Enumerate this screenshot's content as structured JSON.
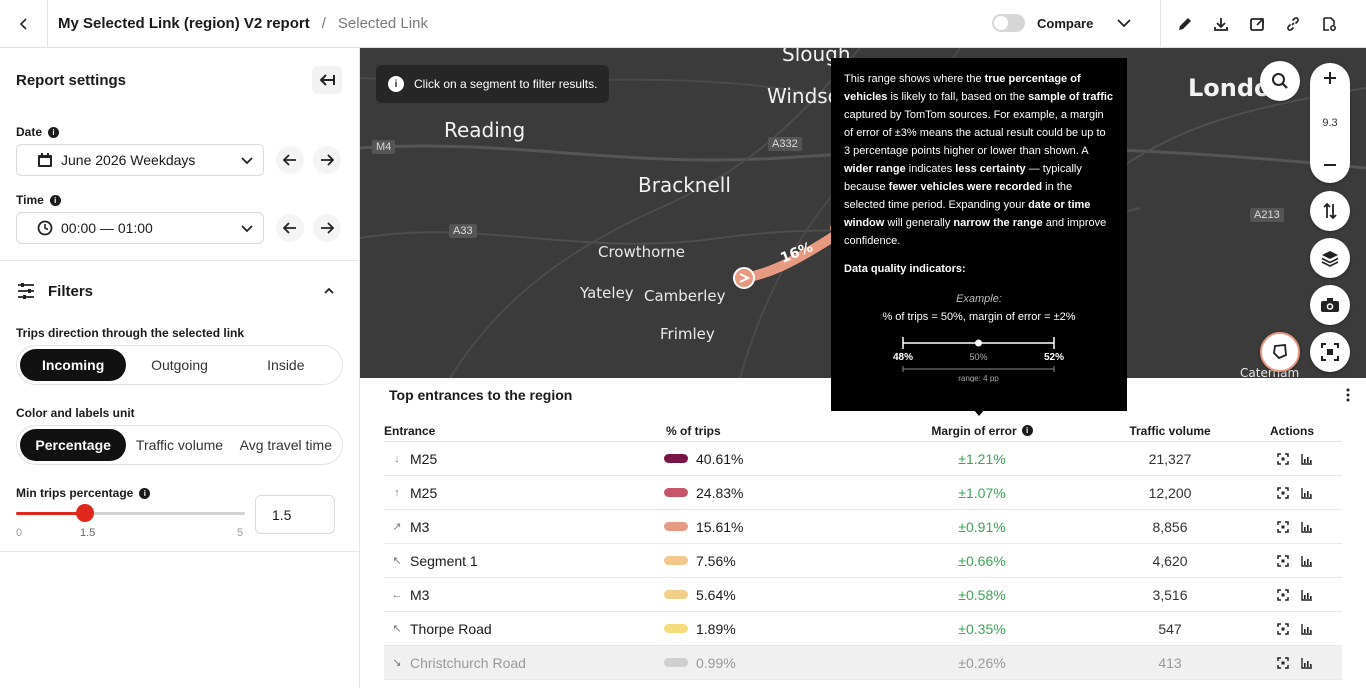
{
  "header": {
    "title": "My Selected Link (region) V2 report",
    "separator": "/",
    "breadcrumb": "Selected Link",
    "compare_label": "Compare"
  },
  "settings": {
    "heading": "Report settings",
    "date_label": "Date",
    "date_value": "June 2026 Weekdays",
    "time_label": "Time",
    "time_value": "00:00 — 01:00"
  },
  "filters": {
    "heading": "Filters",
    "direction_label": "Trips direction through the selected link",
    "direction_options": [
      "Incoming",
      "Outgoing",
      "Inside"
    ],
    "direction_selected": "Incoming",
    "unit_label": "Color and labels unit",
    "unit_options": [
      "Percentage",
      "Traffic volume",
      "Avg travel time"
    ],
    "unit_selected": "Percentage",
    "min_trips_label": "Min trips percentage",
    "slider_min": "0",
    "slider_value": "1.5",
    "slider_max": "5",
    "slider_fraction": 0.3,
    "input_value": "1.5"
  },
  "map": {
    "info_text": "Click on a segment to filter results.",
    "zoom_level": "9.3",
    "route_label": "16%",
    "places": {
      "slough": "Slough",
      "windsor": "Windso",
      "london": "Londo",
      "reading": "Reading",
      "bracknell": "Bracknell",
      "crowthorne": "Crowthorne",
      "yateley": "Yateley",
      "camberley": "Camberley",
      "frimley": "Frimley",
      "caterham": "Caterham"
    },
    "road_signs": {
      "m4": "M4",
      "a332": "A332",
      "a33": "A33",
      "a213": "A213"
    }
  },
  "tooltip": {
    "p1_a": "This range shows where the ",
    "p1_b": "true percentage of vehicles",
    "p1_c": " is likely to fall, based on the ",
    "p1_d": "sample of traffic",
    "p1_e": " captured by TomTom sources. For example, a margin of error of ±3% means the actual result could be up to 3 percentage points higher or lower than shown. A ",
    "p1_f": "wider range",
    "p1_g": " indicates ",
    "p1_h": "less certainty",
    "p1_i": " — typically because ",
    "p1_j": "fewer vehicles were recorded",
    "p1_k": " in the selected time period. Expanding your ",
    "p1_l": "date or time window",
    "p1_m": " will generally ",
    "p1_n": "narrow the range",
    "p1_o": " and improve confidence.",
    "dq_heading": "Data quality indicators:",
    "example_label": "Example:",
    "example_text": "% of trips = 50%, margin of error = ±2%",
    "scale_low": "48%",
    "scale_mid": "50%",
    "scale_high": "52%",
    "range_text": "range: 4 pp"
  },
  "table": {
    "title": "Top entrances to the region",
    "columns": {
      "entrance": "Entrance",
      "pct": "% of trips",
      "moe": "Margin of error",
      "volume": "Traffic volume",
      "actions": "Actions"
    },
    "rows": [
      {
        "dir": "↓",
        "entrance": "M25",
        "pct": "40.61%",
        "color": "#7a1548",
        "moe": "±1.21%",
        "volume": "21,327"
      },
      {
        "dir": "↑",
        "entrance": "M25",
        "pct": "24.83%",
        "color": "#c8566b",
        "moe": "±1.07%",
        "volume": "12,200"
      },
      {
        "dir": "↗",
        "entrance": "M3",
        "pct": "15.61%",
        "color": "#e69a84",
        "moe": "±0.91%",
        "volume": "8,856"
      },
      {
        "dir": "↖",
        "entrance": "Segment 1",
        "pct": "7.56%",
        "color": "#f2c78a",
        "moe": "±0.66%",
        "volume": "4,620"
      },
      {
        "dir": "←",
        "entrance": "M3",
        "pct": "5.64%",
        "color": "#f2cf86",
        "moe": "±0.58%",
        "volume": "3,516"
      },
      {
        "dir": "↖",
        "entrance": "Thorpe Road",
        "pct": "1.89%",
        "color": "#f5dc7a",
        "moe": "±0.35%",
        "volume": "547"
      },
      {
        "dir": "↘",
        "entrance": "Christchurch Road",
        "pct": "0.99%",
        "color": "#cfcfcf",
        "moe": "±0.26%",
        "volume": "413",
        "dim": true
      }
    ]
  }
}
